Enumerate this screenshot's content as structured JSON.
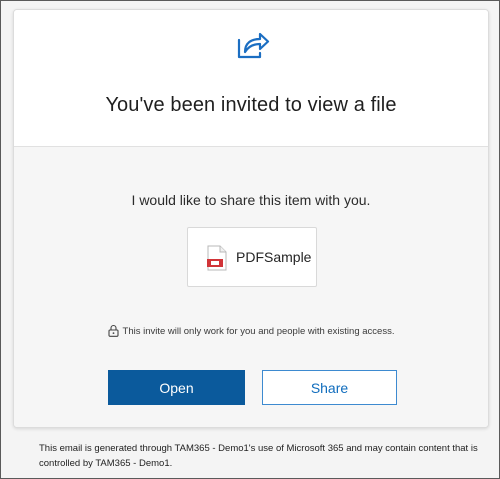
{
  "header": {
    "icon": "share-arrow-icon",
    "title": "You've been invited to view a file"
  },
  "body": {
    "message": "I would like to share this item with you.",
    "file": {
      "icon": "pdf-file-icon",
      "name": "PDFSample"
    },
    "access_note": {
      "icon": "lock-icon",
      "text": "This invite will only work for you and people with existing access."
    },
    "buttons": {
      "open_label": "Open",
      "share_label": "Share"
    }
  },
  "footer": {
    "text": "This email is generated through TAM365 - Demo1's use of Microsoft 365 and may contain content that is controlled by TAM365 - Demo1."
  },
  "colors": {
    "accent": "#0b5a9c",
    "link": "#0f6cbd",
    "pdf_red": "#d13438"
  }
}
